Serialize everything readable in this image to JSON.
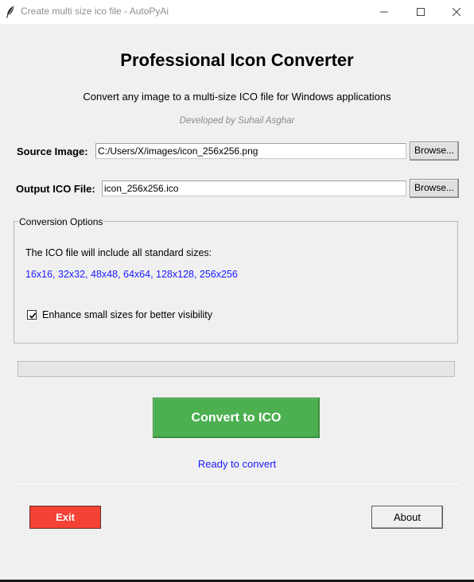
{
  "window": {
    "title": "Create multi size ico file - AutoPyAi",
    "icon": "feather-icon",
    "controls": [
      "minimize-icon",
      "maximize-icon",
      "close-icon"
    ]
  },
  "header": {
    "title": "Professional Icon Converter",
    "subtitle": "Convert any image to a multi-size ICO file for Windows applications",
    "developer": "Developed by Suhail Asghar"
  },
  "source": {
    "label": "Source Image:",
    "value": "C:/Users/X/images/icon_256x256.png",
    "browse_label": "Browse..."
  },
  "output": {
    "label": "Output ICO File:",
    "value": "icon_256x256.ico",
    "browse_label": "Browse..."
  },
  "options": {
    "legend": "Conversion Options",
    "description": "The ICO file will include all standard sizes:",
    "sizes": "16x16, 32x32, 48x48, 64x64, 128x128, 256x256",
    "enhance_label": "Enhance small sizes for better visibility",
    "enhance_checked": true
  },
  "progress": {
    "value": 0
  },
  "actions": {
    "convert_label": "Convert to ICO",
    "status": "Ready to convert",
    "exit_label": "Exit",
    "about_label": "About"
  },
  "colors": {
    "convert": "#4caf50",
    "exit": "#f44336",
    "status_text": "#1a1aff",
    "sizes_text": "#1a1aff"
  }
}
